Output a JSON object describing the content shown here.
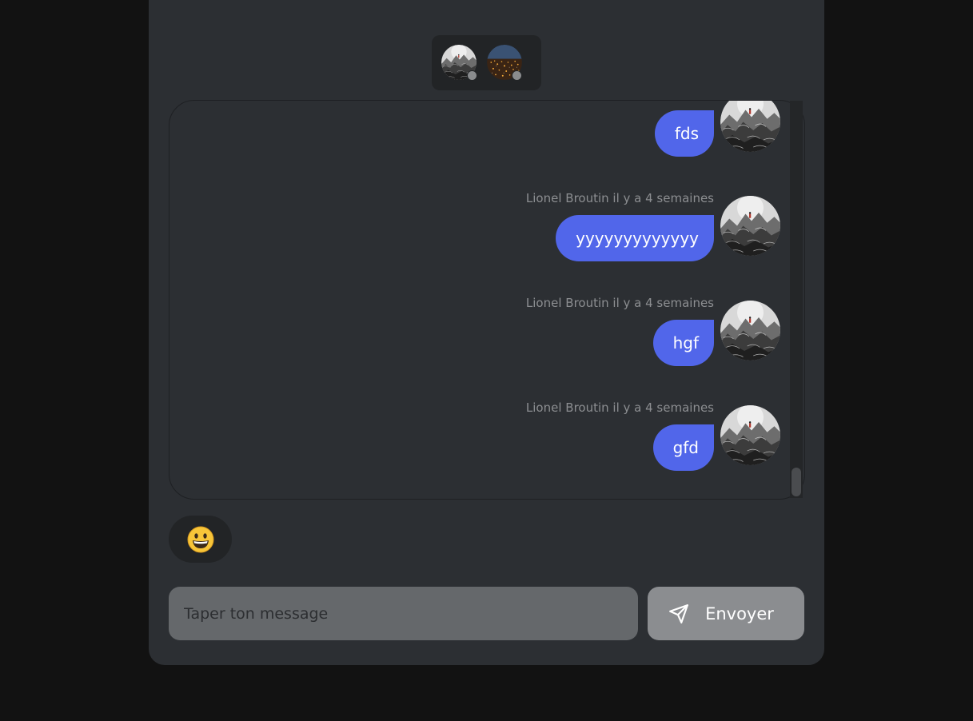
{
  "participants": [
    {
      "name": "Lionel Broutin",
      "avatar": "mountain-sketch-avatar",
      "status": "offline"
    },
    {
      "name": "",
      "avatar": "city-lights-avatar",
      "status": "offline"
    }
  ],
  "messages": [
    {
      "author": "",
      "time": "",
      "text": "fds"
    },
    {
      "author": "Lionel Broutin",
      "time": "il y a 4 semaines",
      "meta": "Lionel Broutin il y a 4 semaines",
      "text": "yyyyyyyyyyyyy"
    },
    {
      "author": "Lionel Broutin",
      "time": "il y a 4 semaines",
      "meta": "Lionel Broutin il y a 4 semaines",
      "text": "hgf"
    },
    {
      "author": "Lionel Broutin",
      "time": "il y a 4 semaines",
      "meta": "Lionel Broutin il y a 4 semaines",
      "text": "gfd"
    }
  ],
  "emoji_picker": {
    "icon": "😀"
  },
  "composer": {
    "placeholder": "Taper ton message",
    "value": "",
    "send_label": "Envoyer",
    "send_icon": "paper-plane-icon"
  },
  "colors": {
    "background": "#121212",
    "card": "#2c2f33",
    "bubble": "#5166ea",
    "send_button": "#8b8d90",
    "input": "#65686b"
  }
}
